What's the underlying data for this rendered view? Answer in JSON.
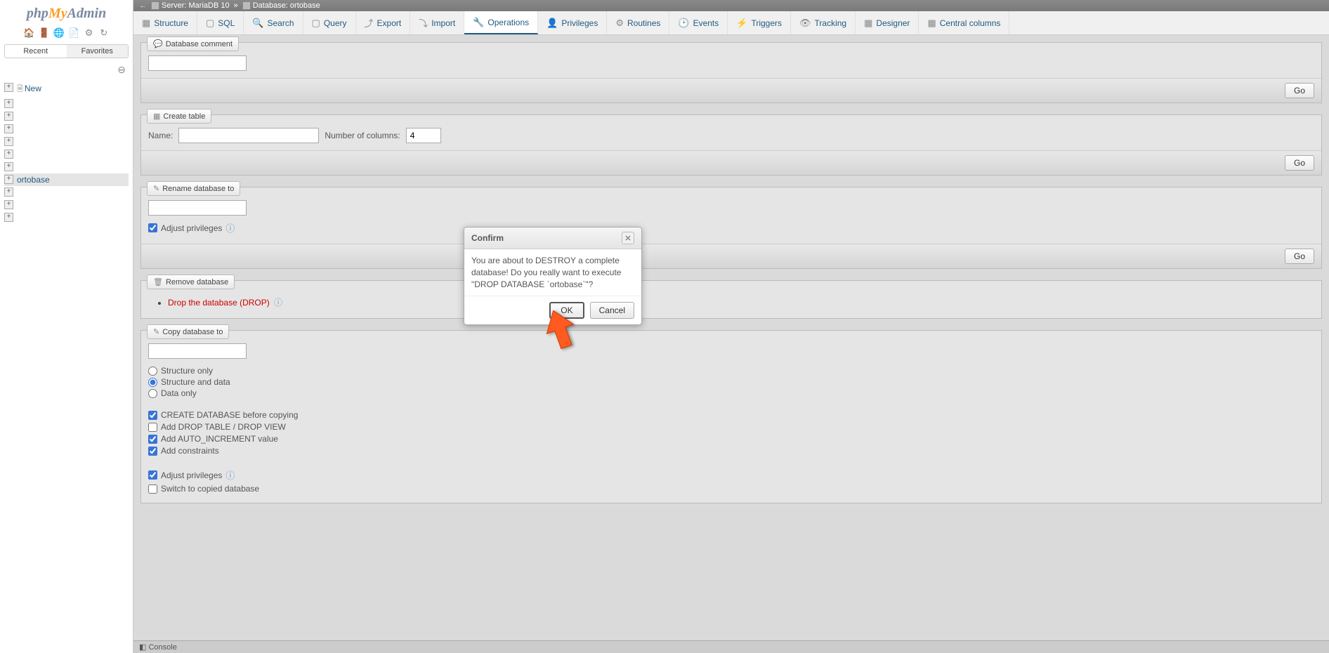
{
  "logo": {
    "p1": "php",
    "p2": "My",
    "p3": "Admin"
  },
  "sidebar": {
    "tabs": [
      "Recent",
      "Favorites"
    ],
    "new_label": "New",
    "selected_db": "ortobase"
  },
  "breadcrumb": {
    "server_label": "Server: MariaDB 10",
    "sep": "»",
    "db_label": "Database: ortobase"
  },
  "tabs": [
    "Structure",
    "SQL",
    "Search",
    "Query",
    "Export",
    "Import",
    "Operations",
    "Privileges",
    "Routines",
    "Events",
    "Triggers",
    "Tracking",
    "Designer",
    "Central columns"
  ],
  "active_tab_index": 6,
  "sections": {
    "db_comment": {
      "legend": "Database comment",
      "go": "Go"
    },
    "create_table": {
      "legend": "Create table",
      "name_label": "Name:",
      "cols_label": "Number of columns:",
      "cols_value": "4",
      "go": "Go"
    },
    "rename_db": {
      "legend": "Rename database to",
      "adjust_label": "Adjust privileges",
      "go": "Go"
    },
    "remove_db": {
      "legend": "Remove database",
      "drop_link": "Drop the database (DROP)"
    },
    "copy_db": {
      "legend": "Copy database to",
      "opt_structure_only": "Structure only",
      "opt_structure_data": "Structure and data",
      "opt_data_only": "Data only",
      "chk_create_before": "CREATE DATABASE before copying",
      "chk_add_drop": "Add DROP TABLE / DROP VIEW",
      "chk_auto_inc": "Add AUTO_INCREMENT value",
      "chk_constraints": "Add constraints",
      "chk_adjust_priv": "Adjust privileges",
      "chk_switch": "Switch to copied database"
    }
  },
  "console_label": "Console",
  "modal": {
    "title": "Confirm",
    "body": "You are about to DESTROY a complete database! Do you really want to execute \"DROP DATABASE `ortobase`\"?",
    "ok": "OK",
    "cancel": "Cancel"
  }
}
